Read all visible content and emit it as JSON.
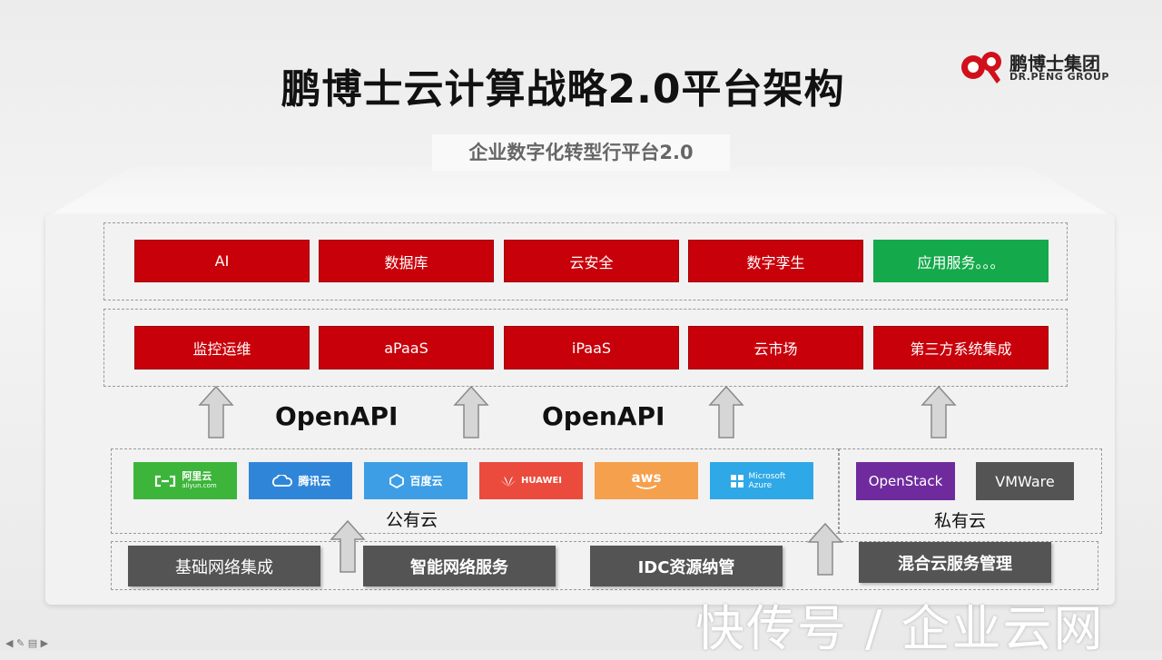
{
  "title": "鹏博士云计算战略2.0平台架构",
  "logo": {
    "name_cn": "鹏博士集团",
    "name_en": "DR.PENG GROUP"
  },
  "platform_label": "企业数字化转型行平台2.0",
  "row1": [
    {
      "label": "AI",
      "color": "#c8000a"
    },
    {
      "label": "数据库",
      "color": "#c8000a"
    },
    {
      "label": "云安全",
      "color": "#c8000a"
    },
    {
      "label": "数字孪生",
      "color": "#c8000a"
    },
    {
      "label": "应用服务。。。",
      "color": "#14a94a"
    }
  ],
  "row2": [
    "监控运维",
    "aPaaS",
    "iPaaS",
    "云市场",
    "第三方系统集成"
  ],
  "openapi": [
    "OpenAPI",
    "OpenAPI"
  ],
  "public_cloud": {
    "label": "公有云",
    "providers": [
      {
        "name": "阿里云",
        "sub": "aliyun.com",
        "color": "#3cb53a",
        "icon": "aliyun-icon"
      },
      {
        "name": "腾讯云",
        "color": "#2f86d9",
        "icon": "tencent-cloud-icon"
      },
      {
        "name": "百度云",
        "color": "#3d9ee6",
        "icon": "baidu-cloud-icon"
      },
      {
        "name": "HUAWEI",
        "color": "#ea4b3c",
        "icon": "huawei-icon"
      },
      {
        "name": "aws",
        "color": "#f5a04c",
        "icon": "aws-icon"
      },
      {
        "name": "Microsoft Azure",
        "color": "#2ea8e6",
        "icon": "windows-icon"
      }
    ]
  },
  "private_cloud": {
    "label": "私有云",
    "providers": [
      {
        "name": "OpenStack",
        "color": "#6f2b9d"
      },
      {
        "name": "VMWare",
        "color": "#545454"
      }
    ]
  },
  "base_services": [
    "基础网络集成",
    "智能网络服务",
    "IDC资源纳管",
    "混合云服务管理"
  ],
  "watermark": "快传号 / 企业云网"
}
